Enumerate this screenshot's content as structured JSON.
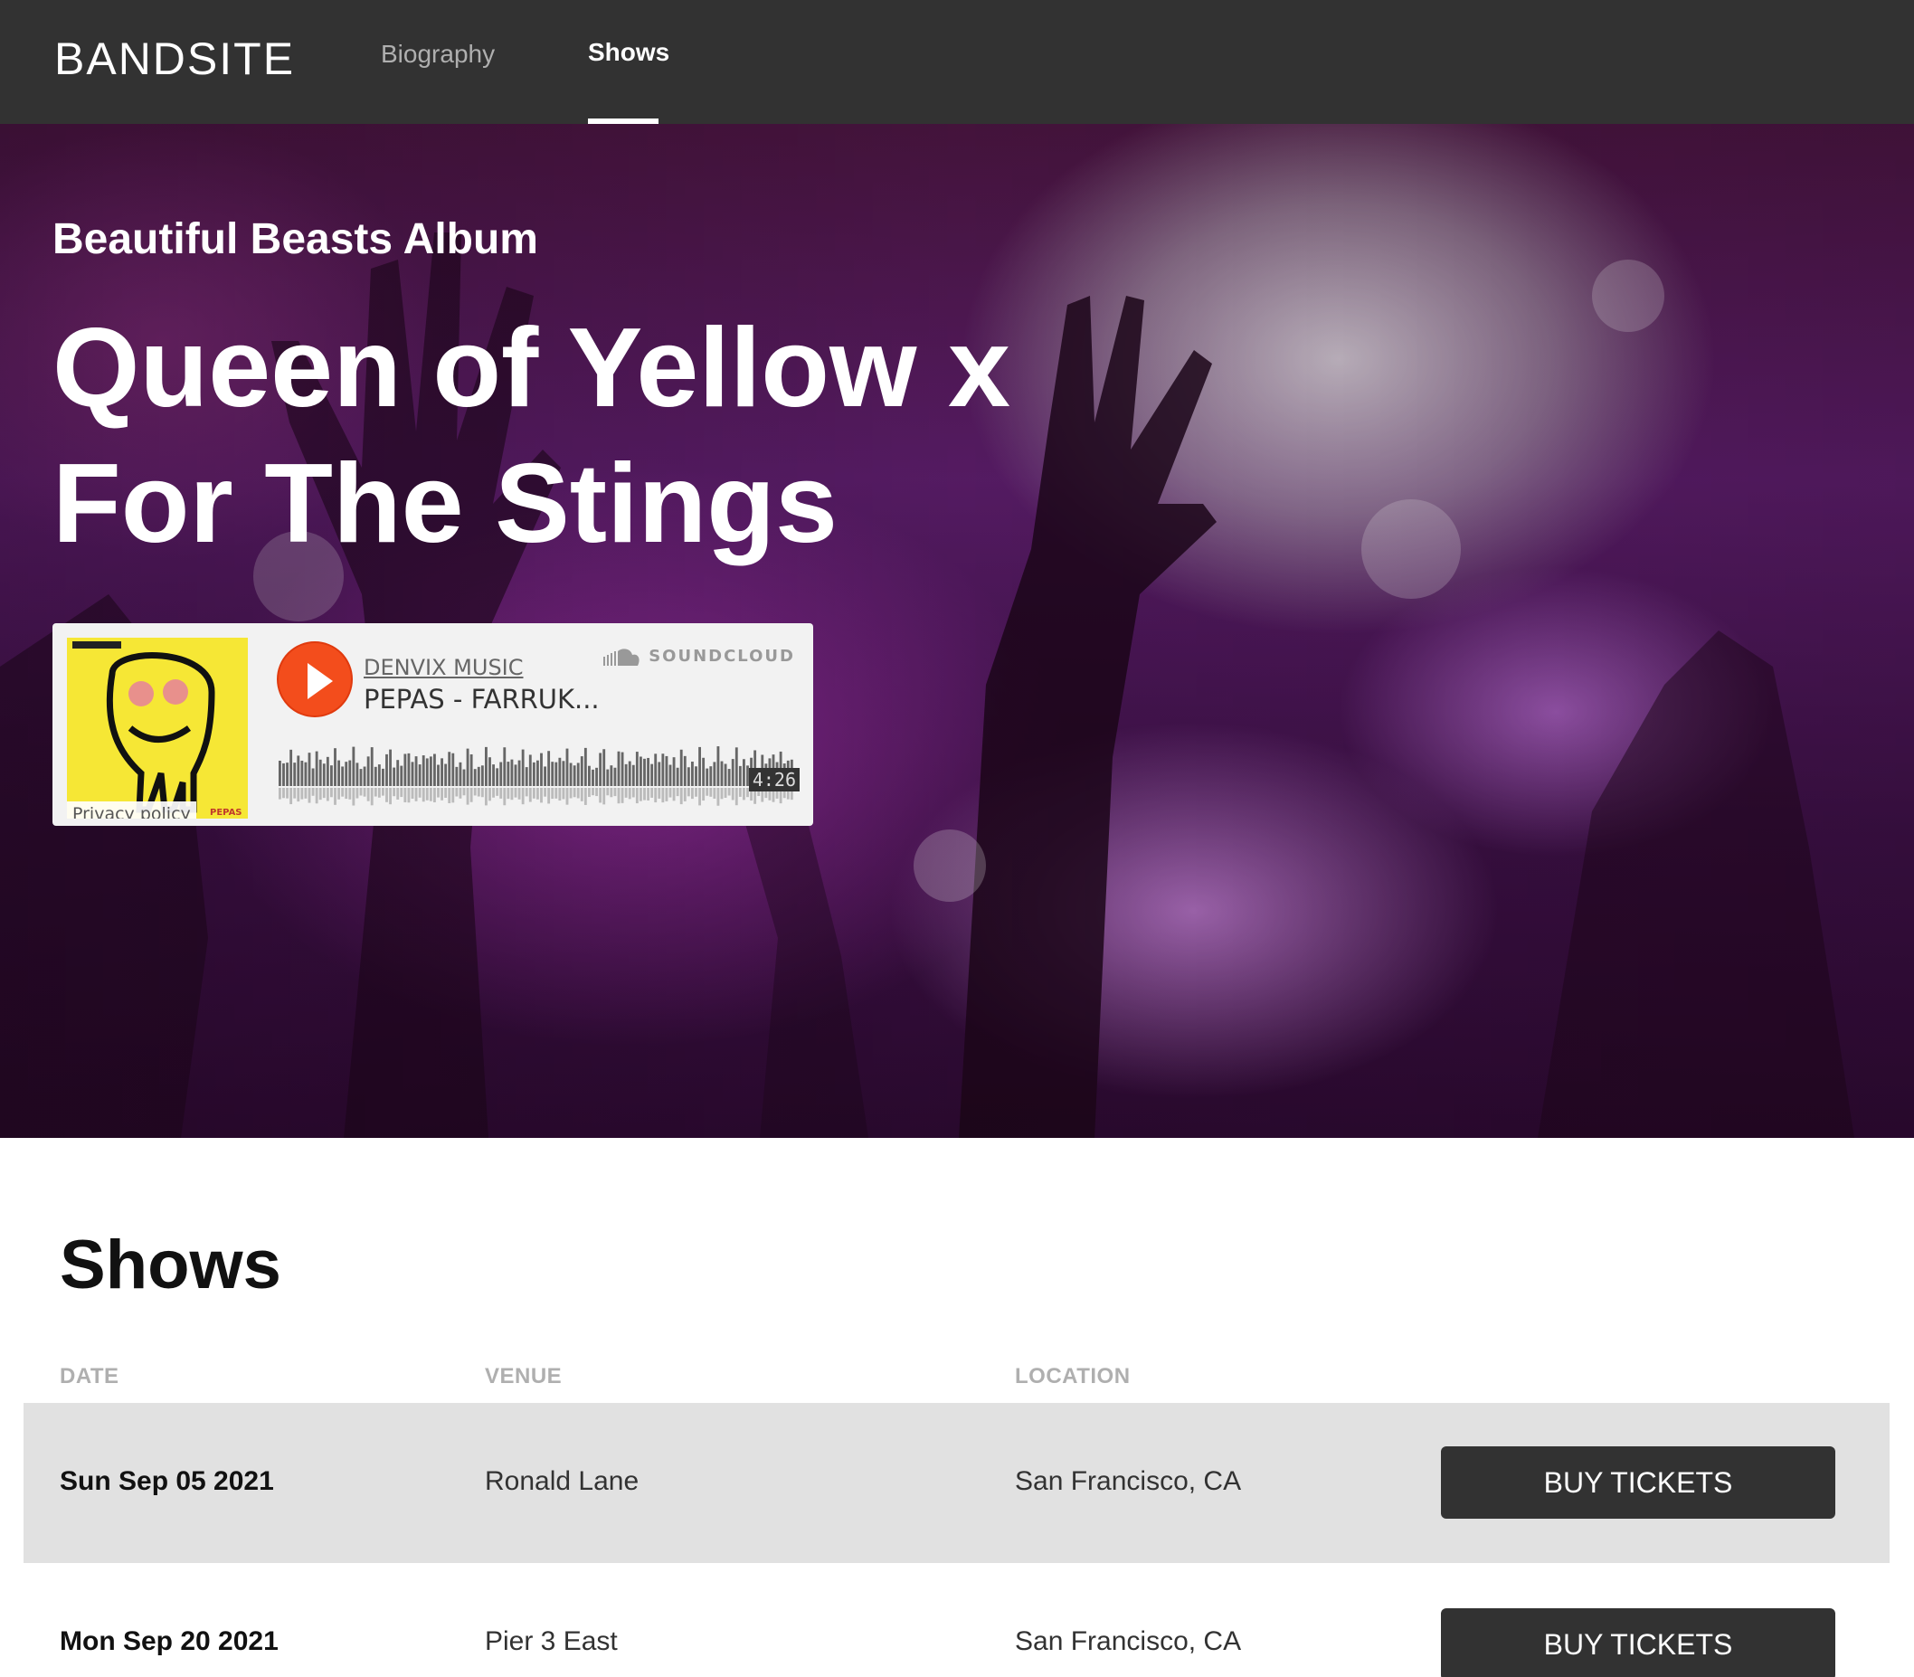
{
  "header": {
    "logo": "BANDSITE",
    "nav": [
      {
        "label": "Biography",
        "active": false
      },
      {
        "label": "Shows",
        "active": true
      }
    ]
  },
  "hero": {
    "subtitle": "Beautiful Beasts Album",
    "title": "Queen of Yellow x For The Stings"
  },
  "soundcloud": {
    "artist": "DENVIX MUSIC",
    "track": "PEPAS - FARRUK...",
    "brand": "SOUNDCLOUD",
    "duration": "4:26",
    "privacy": "Privacy policy",
    "art_label": "PEPAS",
    "accent": "#f34d1c"
  },
  "shows": {
    "title": "Shows",
    "columns": [
      "DATE",
      "VENUE",
      "LOCATION"
    ],
    "rows": [
      {
        "date": "Sun Sep 05 2021",
        "venue": "Ronald Lane",
        "location": "San Francisco, CA",
        "button": "BUY TICKETS",
        "selected": true
      },
      {
        "date": "Mon Sep 20 2021",
        "venue": "Pier 3 East",
        "location": "San Francisco, CA",
        "button": "BUY TICKETS",
        "selected": false
      }
    ]
  },
  "colors": {
    "header_bg": "#323232",
    "selected_row_bg": "#e1e1e1",
    "button_bg": "#323232"
  }
}
